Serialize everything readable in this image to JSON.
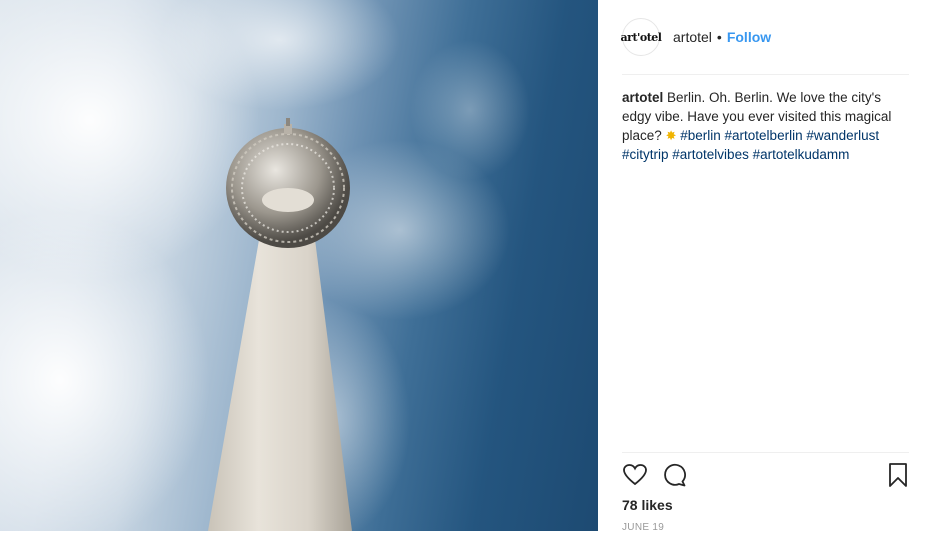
{
  "post": {
    "image_alt": "Fernsehturm Berlin against blue sky",
    "header": {
      "avatar_text": "art'otel",
      "username": "artotel",
      "separator": "•",
      "follow_label": "Follow"
    },
    "caption": {
      "username": "artotel",
      "text": "Berlin. Oh. Berlin. We love the city's edgy vibe. Have you ever visited this magical place?",
      "emoji": "✸",
      "hashtags": [
        "#berlin",
        "#artotelberlin",
        "#wanderlust",
        "#citytrip",
        "#artotelvibes",
        "#artotelkudamm"
      ]
    },
    "likes": "78 likes",
    "date": "JUNE 19"
  },
  "icons": [
    "heart-icon",
    "comment-icon",
    "bookmark-icon"
  ],
  "colors": {
    "link": "#3897f0",
    "hashtag": "#003569",
    "text": "#262626"
  }
}
